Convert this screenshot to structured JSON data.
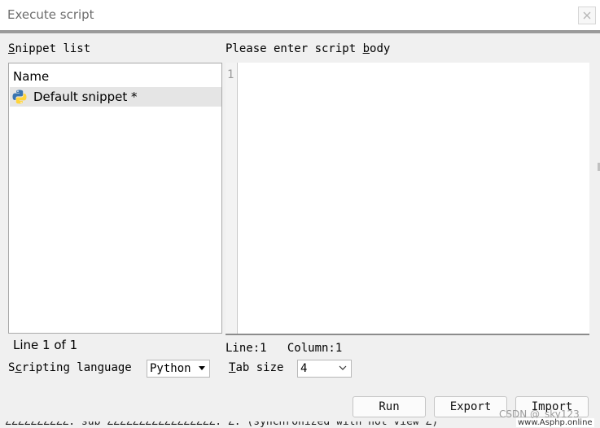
{
  "window": {
    "title": "Execute script",
    "close_icon": "close-icon"
  },
  "snippets": {
    "label_pre": "",
    "label_u": "S",
    "label_post": "nippet list",
    "column_header": "Name",
    "items": [
      {
        "label": "Default snippet *",
        "icon": "python-icon"
      }
    ],
    "status": "Line 1 of 1"
  },
  "editor": {
    "label_pre": "Please enter script ",
    "label_u": "b",
    "label_post": "ody",
    "line_number": "1",
    "body": "",
    "cursor_status": "Line:1   Column:1"
  },
  "language": {
    "label_pre": "S",
    "label_u": "c",
    "label_post": "ripting language",
    "selected": "Python"
  },
  "tab_size": {
    "label_pre": "",
    "label_u": "T",
    "label_post": "ab size",
    "selected": "4"
  },
  "buttons": {
    "run": "Run",
    "export": "Export",
    "import": "Import"
  },
  "background_text": "ZZZZZZZZZZ: sub ZZZZZZZZZZZZZZZZZ: Z: (synchronized with not view Z)",
  "watermark": {
    "line1": "CSDN @_sky123_",
    "line2": "www.Asphp.online"
  },
  "colors": {
    "title_bar": "#ffffff",
    "title_separator": "#9a9a9a",
    "dialog_bg": "#f0f0f0",
    "selected_row": "#e5e5e5",
    "python_blue": "#3a75b0",
    "python_yellow": "#ffd43b"
  }
}
